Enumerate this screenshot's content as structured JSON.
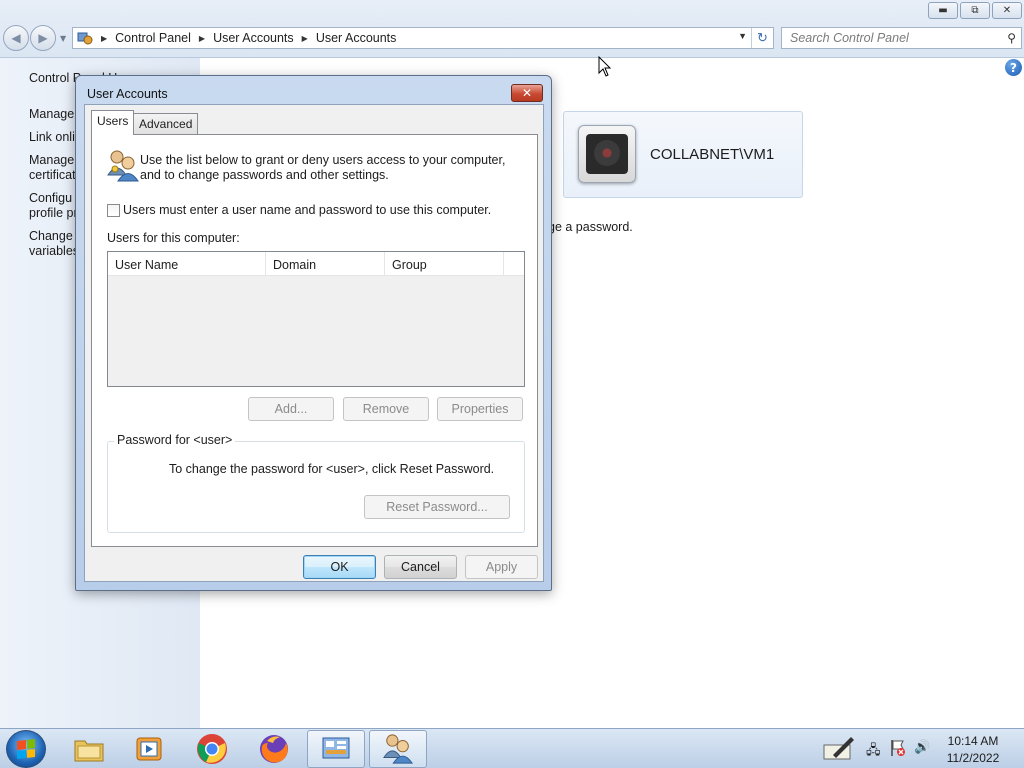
{
  "window": {
    "breadcrumb": [
      "Control Panel",
      "User Accounts",
      "User Accounts"
    ],
    "search_placeholder": "Search Control Panel",
    "left_pane": [
      "Control Panel Home",
      "Manage",
      "Link onli",
      "Manage\ncertificat",
      "Configu\nprofile pr",
      "Change\nvariables"
    ],
    "user_tile_name": "COLLABNET\\VM1",
    "content_snippet": "ge a password."
  },
  "dialog": {
    "title": "User Accounts",
    "tabs": [
      "Users",
      "Advanced"
    ],
    "intro_line1": "Use the list below to grant or deny users access to your computer,",
    "intro_line2": "and to change passwords and other settings.",
    "checkbox_label": "Users must enter a user name and password to use this computer.",
    "checkbox_checked": false,
    "users_list_label": "Users for this computer:",
    "columns": [
      "User Name",
      "Domain",
      "Group"
    ],
    "rows": [],
    "buttons": {
      "add": "Add...",
      "remove": "Remove",
      "properties": "Properties",
      "reset_password": "Reset Password...",
      "ok": "OK",
      "cancel": "Cancel",
      "apply": "Apply"
    },
    "password_group_label": "Password for <user>",
    "password_hint": "To change the password for <user>, click Reset Password."
  },
  "taskbar": {
    "time": "10:14 AM",
    "date": "11/2/2022"
  }
}
